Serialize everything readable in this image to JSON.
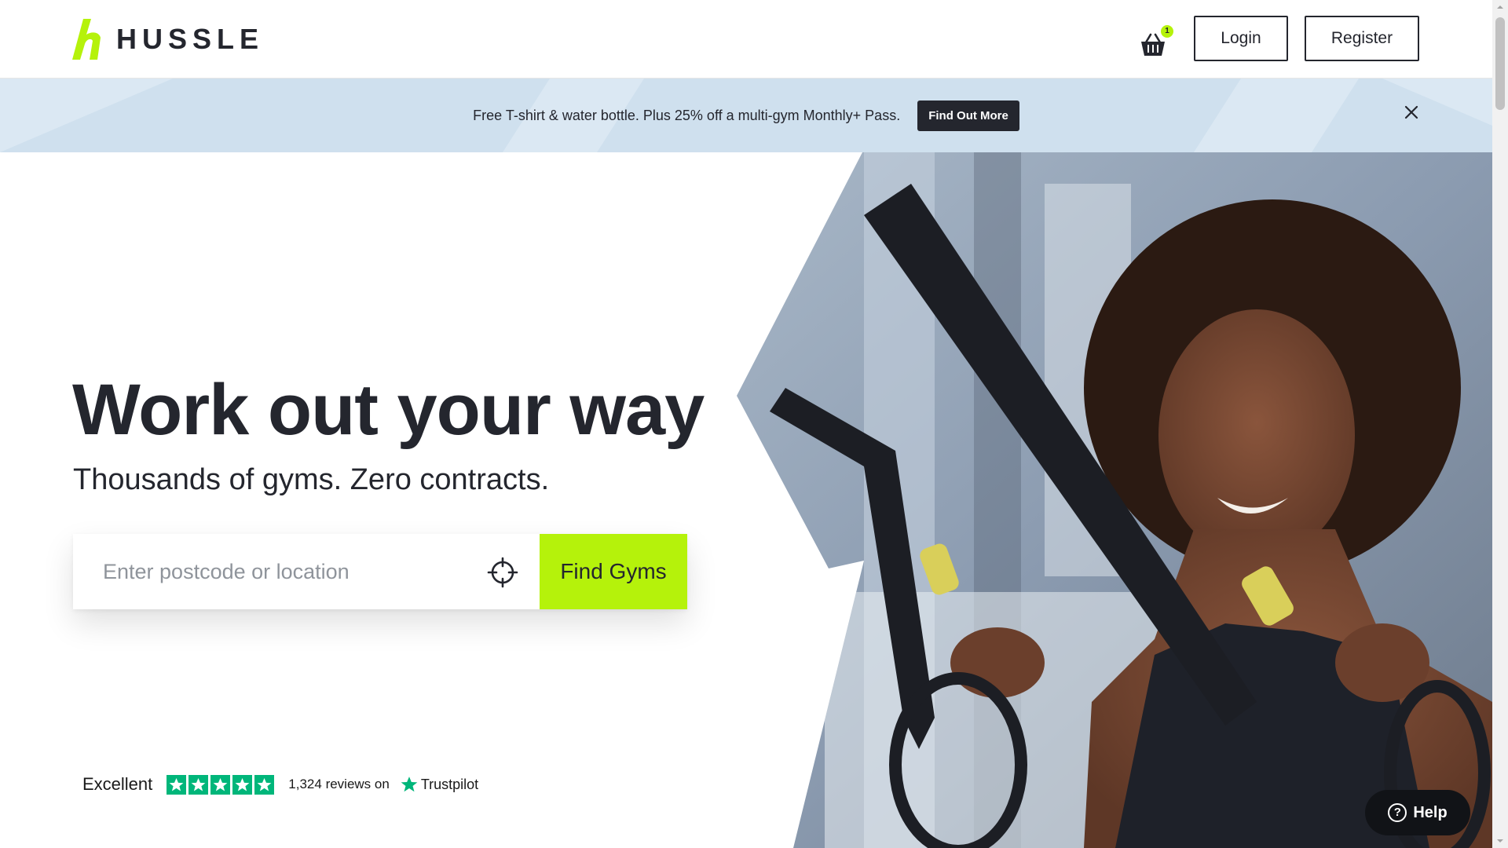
{
  "header": {
    "brand": "HUSSLE",
    "cart_count": "1",
    "login_label": "Login",
    "register_label": "Register"
  },
  "promo": {
    "text": "Free T-shirt & water bottle. Plus 25% off a multi-gym Monthly+ Pass.",
    "button_label": "Find Out More"
  },
  "hero": {
    "title": "Work out your way",
    "subtitle": "Thousands of gyms. Zero contracts.",
    "search_placeholder": "Enter postcode or location",
    "search_value": "",
    "find_button_label": "Find Gyms"
  },
  "trustpilot": {
    "rating_word": "Excellent",
    "stars": 5,
    "review_count": "1,324",
    "reviews_suffix": "reviews on",
    "brand": "Trustpilot"
  },
  "help": {
    "label": "Help"
  },
  "colors": {
    "accent": "#b5f20b",
    "dark": "#24262e",
    "promo_bg": "#cfe0ee",
    "trustpilot_green": "#00b67a"
  },
  "icons": [
    "hussle-logo-icon",
    "basket-icon",
    "close-icon",
    "crosshair-icon",
    "star-icon",
    "question-icon"
  ]
}
